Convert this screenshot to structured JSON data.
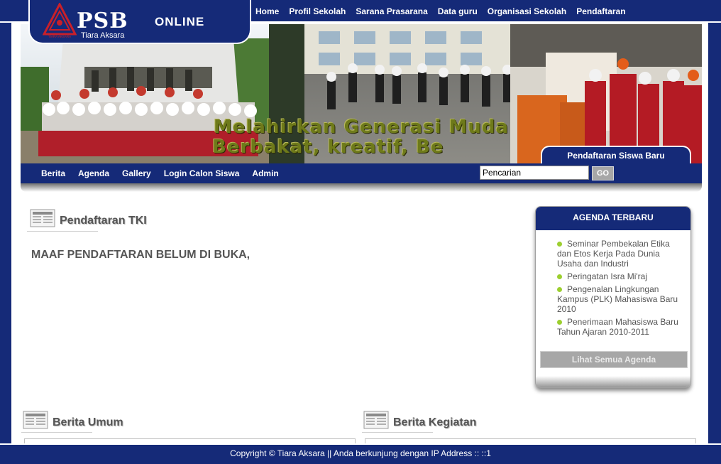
{
  "brand": {
    "psb": "PSB",
    "online": "ONLINE",
    "subtitle": "Tiara Aksara",
    "emblem_text": "TIARA AKSARA"
  },
  "top_nav": [
    "Home",
    "Profil Sekolah",
    "Sarana Prasarana",
    "Data guru",
    "Organisasi Sekolah",
    "Pendaftaran"
  ],
  "banner": {
    "tagline_1": "Melahirkan Generasi Muda",
    "tagline_2": "Berbakat, kreatif, Be",
    "registration_tab": "Pendaftaran Siswa Baru"
  },
  "sub_nav": [
    "Berita",
    "Agenda",
    "Gallery",
    "Login Calon Siswa",
    "Admin"
  ],
  "search": {
    "value": "Pencarian",
    "button": "GO"
  },
  "main": {
    "section_title": "Pendaftaran TKI",
    "notice": "MAAF PENDAFTARAN BELUM DI BUKA,"
  },
  "agenda": {
    "title": "AGENDA TERBARU",
    "items": [
      "Seminar Pembekalan Etika dan Etos Kerja Pada Dunia Usaha dan Industri",
      "Peringatan Isra Mi'raj",
      "Pengenalan Lingkungan Kampus (PLK) Mahasiswa Baru 2010",
      "Penerimaan Mahasiswa Baru Tahun Ajaran 2010-2011"
    ],
    "view_all": "Lihat Semua Agenda"
  },
  "sections": {
    "berita_umum": "Berita Umum",
    "berita_kegiatan": "Berita Kegiatan"
  },
  "footer": {
    "text": "Copyright © Tiara Aksara || Anda berkunjung dengan IP Address :: ::1"
  },
  "colors": {
    "navy": "#152a78",
    "text_gray": "#555555",
    "bullet_green": "#9ccf2f",
    "button_gray": "#a7a7a7"
  }
}
